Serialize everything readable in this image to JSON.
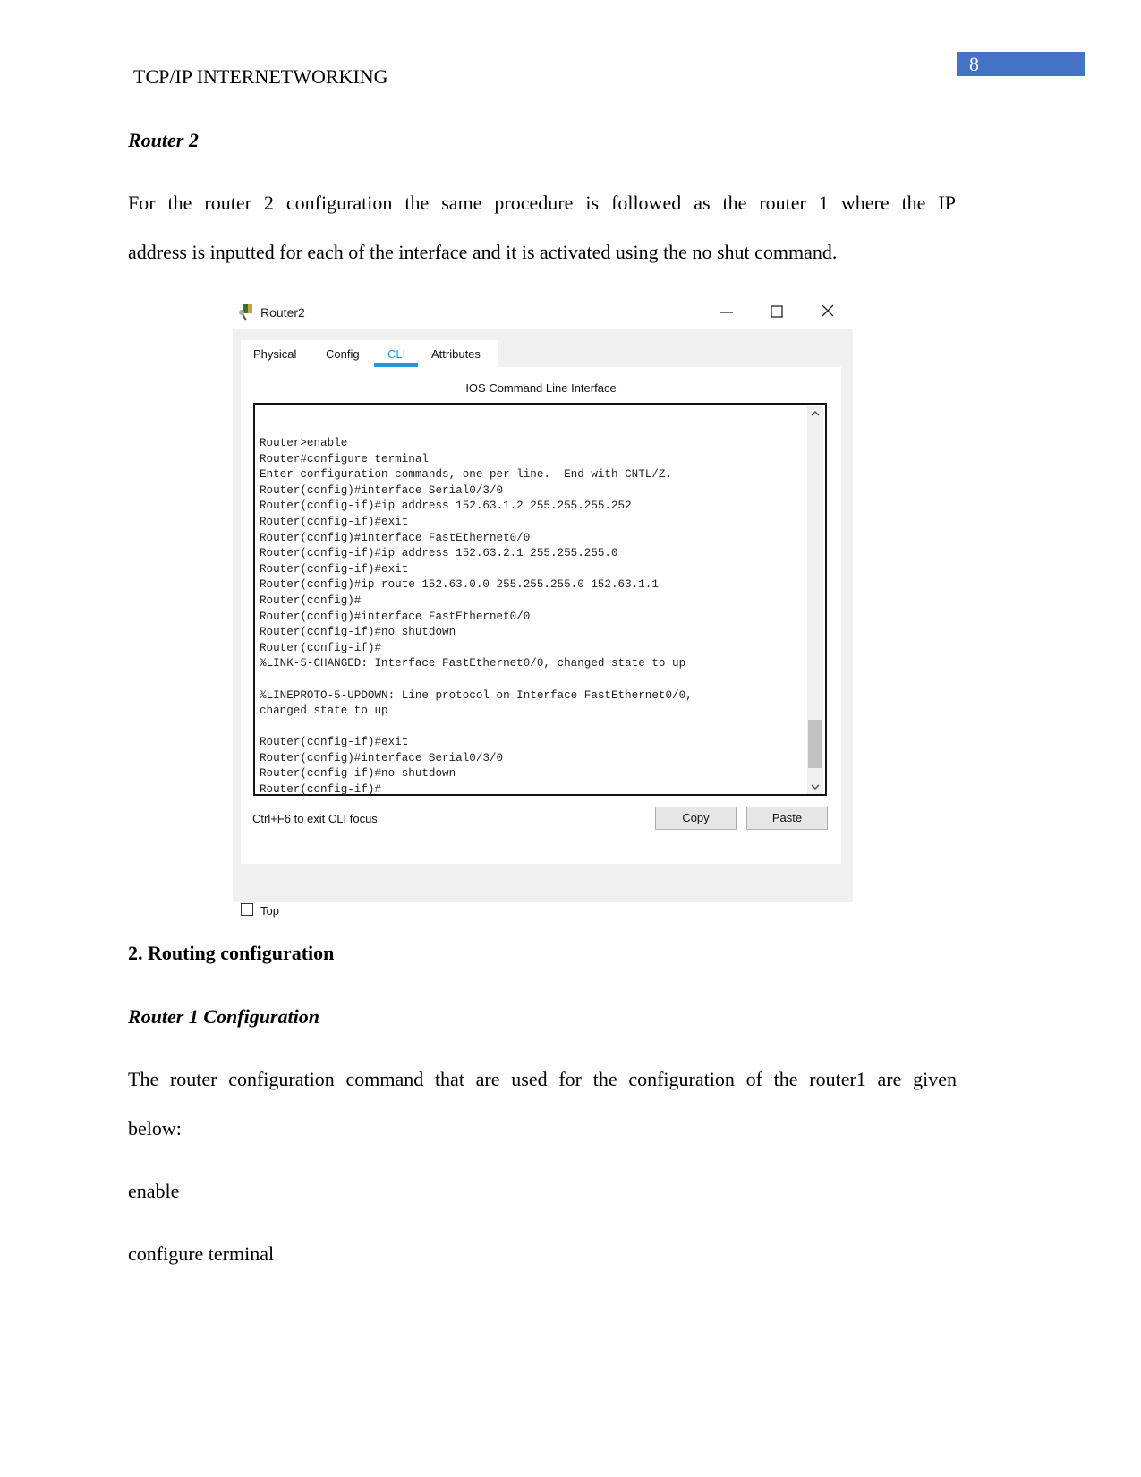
{
  "header": {
    "title": "TCP/IP INTERNETWORKING",
    "page_number": "8",
    "accent_color": "#4472c4"
  },
  "section1": {
    "heading": "Router 2",
    "paragraph_line1": "For the router 2 configuration the same procedure is followed as the router 1 where the IP",
    "paragraph_line2": "address is inputted for each of the interface and it is activated using the no shut command."
  },
  "window": {
    "title": "Router2",
    "tabs": [
      {
        "label": "Physical"
      },
      {
        "label": "Config"
      },
      {
        "label": "CLI",
        "active": true
      },
      {
        "label": "Attributes"
      }
    ],
    "panel_title": "IOS Command Line Interface",
    "terminal_text": "Router>enable\nRouter#configure terminal\nEnter configuration commands, one per line.  End with CNTL/Z.\nRouter(config)#interface Serial0/3/0\nRouter(config-if)#ip address 152.63.1.2 255.255.255.252\nRouter(config-if)#exit\nRouter(config)#interface FastEthernet0/0\nRouter(config-if)#ip address 152.63.2.1 255.255.255.0\nRouter(config-if)#exit\nRouter(config)#ip route 152.63.0.0 255.255.255.0 152.63.1.1\nRouter(config)#\nRouter(config)#interface FastEthernet0/0\nRouter(config-if)#no shutdown\nRouter(config-if)#\n%LINK-5-CHANGED: Interface FastEthernet0/0, changed state to up\n\n%LINEPROTO-5-UPDOWN: Line protocol on Interface FastEthernet0/0,\nchanged state to up\n\nRouter(config-if)#exit\nRouter(config)#interface Serial0/3/0\nRouter(config-if)#no shutdown\nRouter(config-if)#",
    "hint": "Ctrl+F6 to exit CLI focus",
    "copy_label": "Copy",
    "paste_label": "Paste",
    "top_label": "Top",
    "top_checked": false,
    "active_tab_color": "#1a9ad6"
  },
  "section2": {
    "heading": "2. Routing configuration",
    "subheading": "Router 1 Configuration",
    "paragraph_line1": "The router configuration command that are used for the configuration of the router1 are given",
    "paragraph_line2": "below:",
    "cmd1": "enable",
    "cmd2": "configure terminal"
  }
}
